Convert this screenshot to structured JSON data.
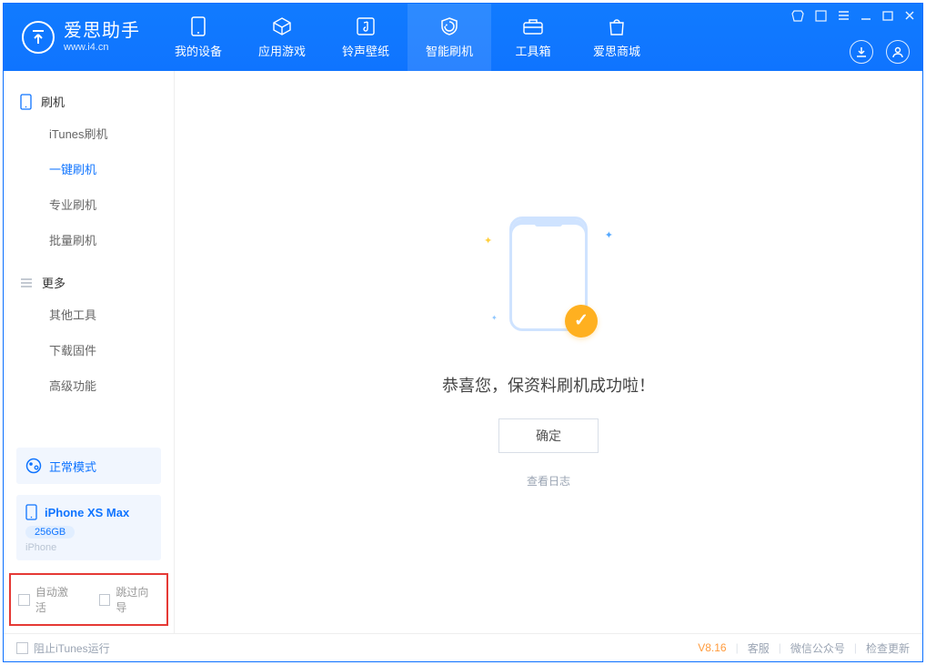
{
  "app": {
    "name_cn": "爱思助手",
    "name_en": "www.i4.cn"
  },
  "nav": [
    {
      "label": "我的设备",
      "icon": "device"
    },
    {
      "label": "应用游戏",
      "icon": "cube"
    },
    {
      "label": "铃声壁纸",
      "icon": "music"
    },
    {
      "label": "智能刷机",
      "icon": "shield",
      "active": true
    },
    {
      "label": "工具箱",
      "icon": "toolbox"
    },
    {
      "label": "爱思商城",
      "icon": "bag"
    }
  ],
  "window_controls": [
    "tshirt",
    "cube-sm",
    "menu",
    "min",
    "max",
    "close"
  ],
  "top_right_icons": [
    "download",
    "user"
  ],
  "sidebar": {
    "groups": [
      {
        "title": "刷机",
        "icon": "phone",
        "items": [
          {
            "label": "iTunes刷机"
          },
          {
            "label": "一键刷机",
            "active": true
          },
          {
            "label": "专业刷机"
          },
          {
            "label": "批量刷机"
          }
        ]
      },
      {
        "title": "更多",
        "icon": "list",
        "items": [
          {
            "label": "其他工具"
          },
          {
            "label": "下载固件"
          },
          {
            "label": "高级功能"
          }
        ]
      }
    ],
    "mode": "正常模式",
    "device": {
      "name": "iPhone XS Max",
      "storage": "256GB",
      "type": "iPhone"
    },
    "options": {
      "auto_activate": "自动激活",
      "skip_guide": "跳过向导"
    }
  },
  "main": {
    "success_message": "恭喜您，保资料刷机成功啦！",
    "ok_button": "确定",
    "view_log": "查看日志"
  },
  "footer": {
    "block_itunes": "阻止iTunes运行",
    "version": "V8.16",
    "links": [
      "客服",
      "微信公众号",
      "检查更新"
    ]
  }
}
